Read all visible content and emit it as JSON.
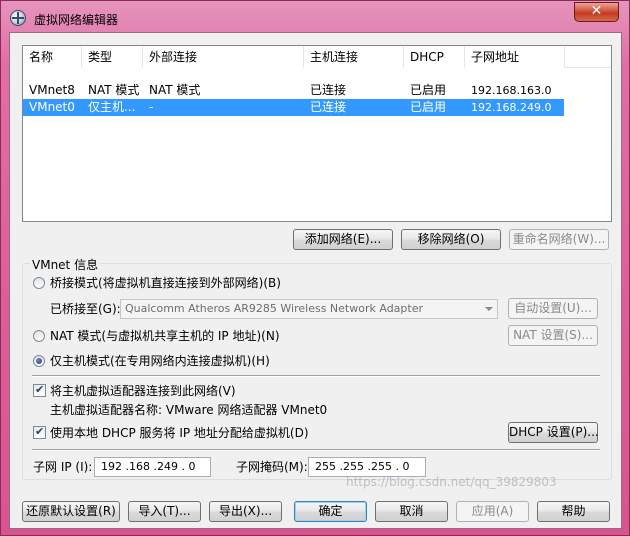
{
  "window": {
    "title": "虚拟网络编辑器",
    "close_label": "✕"
  },
  "networks": {
    "columns": [
      "名称",
      "类型",
      "外部连接",
      "主机连接",
      "DHCP",
      "子网地址"
    ],
    "rows": [
      {
        "name": "VMnet8",
        "type": "NAT 模式",
        "external": "NAT 模式",
        "host": "已连接",
        "dhcp": "已启用",
        "subnet": "192.168.163.0",
        "selected": false
      },
      {
        "name": "VMnet0",
        "type": "仅主机...",
        "external": "-",
        "host": "已连接",
        "dhcp": "已启用",
        "subnet": "192.168.249.0",
        "selected": true
      }
    ]
  },
  "list_buttons": {
    "add": "添加网络(E)...",
    "remove": "移除网络(O)",
    "rename": "重命名网络(W)..."
  },
  "vmnet_info": {
    "group_label": "VMnet 信息",
    "bridged_label": "桥接模式(将虚拟机直接连接到外部网络)(B)",
    "bridged_to_label": "已桥接至(G):",
    "bridged_adapter": "Qualcomm Atheros AR9285 Wireless Network Adapter",
    "auto_settings": "自动设置(U)...",
    "nat_label": "NAT 模式(与虚拟机共享主机的 IP 地址)(N)",
    "nat_settings": "NAT 设置(S)...",
    "hostonly_label": "仅主机模式(在专用网络内连接虚拟机)(H)",
    "connect_adapter_label": "将主机虚拟适配器连接到此网络(V)",
    "adapter_name_label": "主机虚拟适配器名称: VMware 网络适配器 VMnet0",
    "dhcp_label": "使用本地 DHCP 服务将 IP 地址分配给虚拟机(D)",
    "dhcp_settings": "DHCP 设置(P)...",
    "subnet_ip_label": "子网 IP (I):",
    "subnet_ip": "192 .168 .249 . 0",
    "subnet_mask_label": "子网掩码(M):",
    "subnet_mask": "255 .255 .255 . 0",
    "mode": "hostonly",
    "connect_adapter_checked": true,
    "dhcp_checked": true
  },
  "bottom_buttons": {
    "restore": "还原默认设置(R)",
    "import": "导入(T)...",
    "export": "导出(X)...",
    "ok": "确定",
    "cancel": "取消",
    "apply": "应用(A)",
    "help": "帮助"
  },
  "watermark": "https://blog.csdn.net/qq_39829803"
}
